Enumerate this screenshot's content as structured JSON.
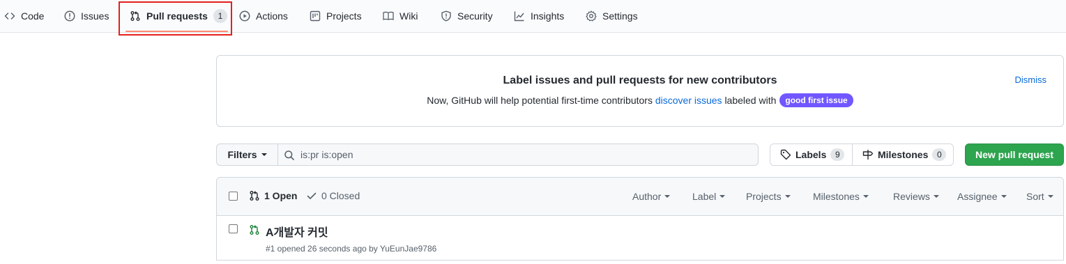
{
  "nav": {
    "code": "Code",
    "issues": "Issues",
    "pull_requests": "Pull requests",
    "pull_requests_count": "1",
    "actions": "Actions",
    "projects": "Projects",
    "wiki": "Wiki",
    "security": "Security",
    "insights": "Insights",
    "settings": "Settings"
  },
  "banner": {
    "title": "Label issues and pull requests for new contributors",
    "text_before": "Now, GitHub will help potential first-time contributors",
    "link": "discover issues",
    "text_after": "labeled with",
    "label": "good first issue",
    "label_color": "#7057ff",
    "dismiss": "Dismiss"
  },
  "filters": {
    "button": "Filters",
    "search_value": "is:pr is:open"
  },
  "labels_button": {
    "label": "Labels",
    "count": "9"
  },
  "milestones_button": {
    "label": "Milestones",
    "count": "0"
  },
  "new_pr_button": "New pull request",
  "list_header": {
    "open": "1 Open",
    "closed": "0 Closed",
    "author": "Author",
    "label": "Label",
    "projects": "Projects",
    "milestones": "Milestones",
    "reviews": "Reviews",
    "assignee": "Assignee",
    "sort": "Sort"
  },
  "pull_requests": [
    {
      "title": "A개발자 커밋",
      "meta": "#1 opened 26 seconds ago by YuEunJae9786"
    }
  ],
  "colors": {
    "accent": "#0969da",
    "primary_button": "#2da44e",
    "selected_tab_underline": "#fd8c73",
    "highlight_box": "#e3201b",
    "open_icon": "#1a7f37"
  }
}
